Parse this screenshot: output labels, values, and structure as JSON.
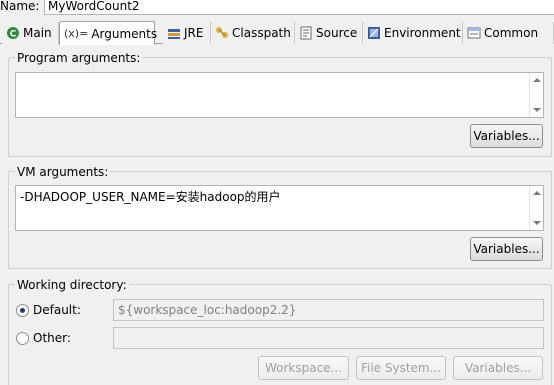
{
  "header": {
    "name_label": "Name:",
    "name_value": "MyWordCount2"
  },
  "tabs": [
    {
      "label": "Main",
      "icon": "main-tab-icon"
    },
    {
      "label": "Arguments",
      "icon": "arguments-tab-icon",
      "icon_text": "(x)=",
      "active": true
    },
    {
      "label": "JRE",
      "icon": "jre-icon"
    },
    {
      "label": "Classpath",
      "icon": "classpath-icon"
    },
    {
      "label": "Source",
      "icon": "source-icon"
    },
    {
      "label": "Environment",
      "icon": "environment-icon"
    },
    {
      "label": "Common",
      "icon": "common-icon"
    }
  ],
  "program_args": {
    "title": "Program arguments:",
    "value": "",
    "variables_label": "Variables..."
  },
  "vm_args": {
    "title": "VM arguments:",
    "value": "-DHADOOP_USER_NAME=安装hadoop的用户",
    "variables_label": "Variables..."
  },
  "working_dir": {
    "title": "Working directory:",
    "default_label": "Default:",
    "default_value": "${workspace_loc:hadoop2.2}",
    "other_label": "Other:",
    "other_value": "",
    "selected": "default",
    "workspace_button": "Workspace...",
    "filesystem_button": "File System...",
    "variables_button": "Variables..."
  }
}
